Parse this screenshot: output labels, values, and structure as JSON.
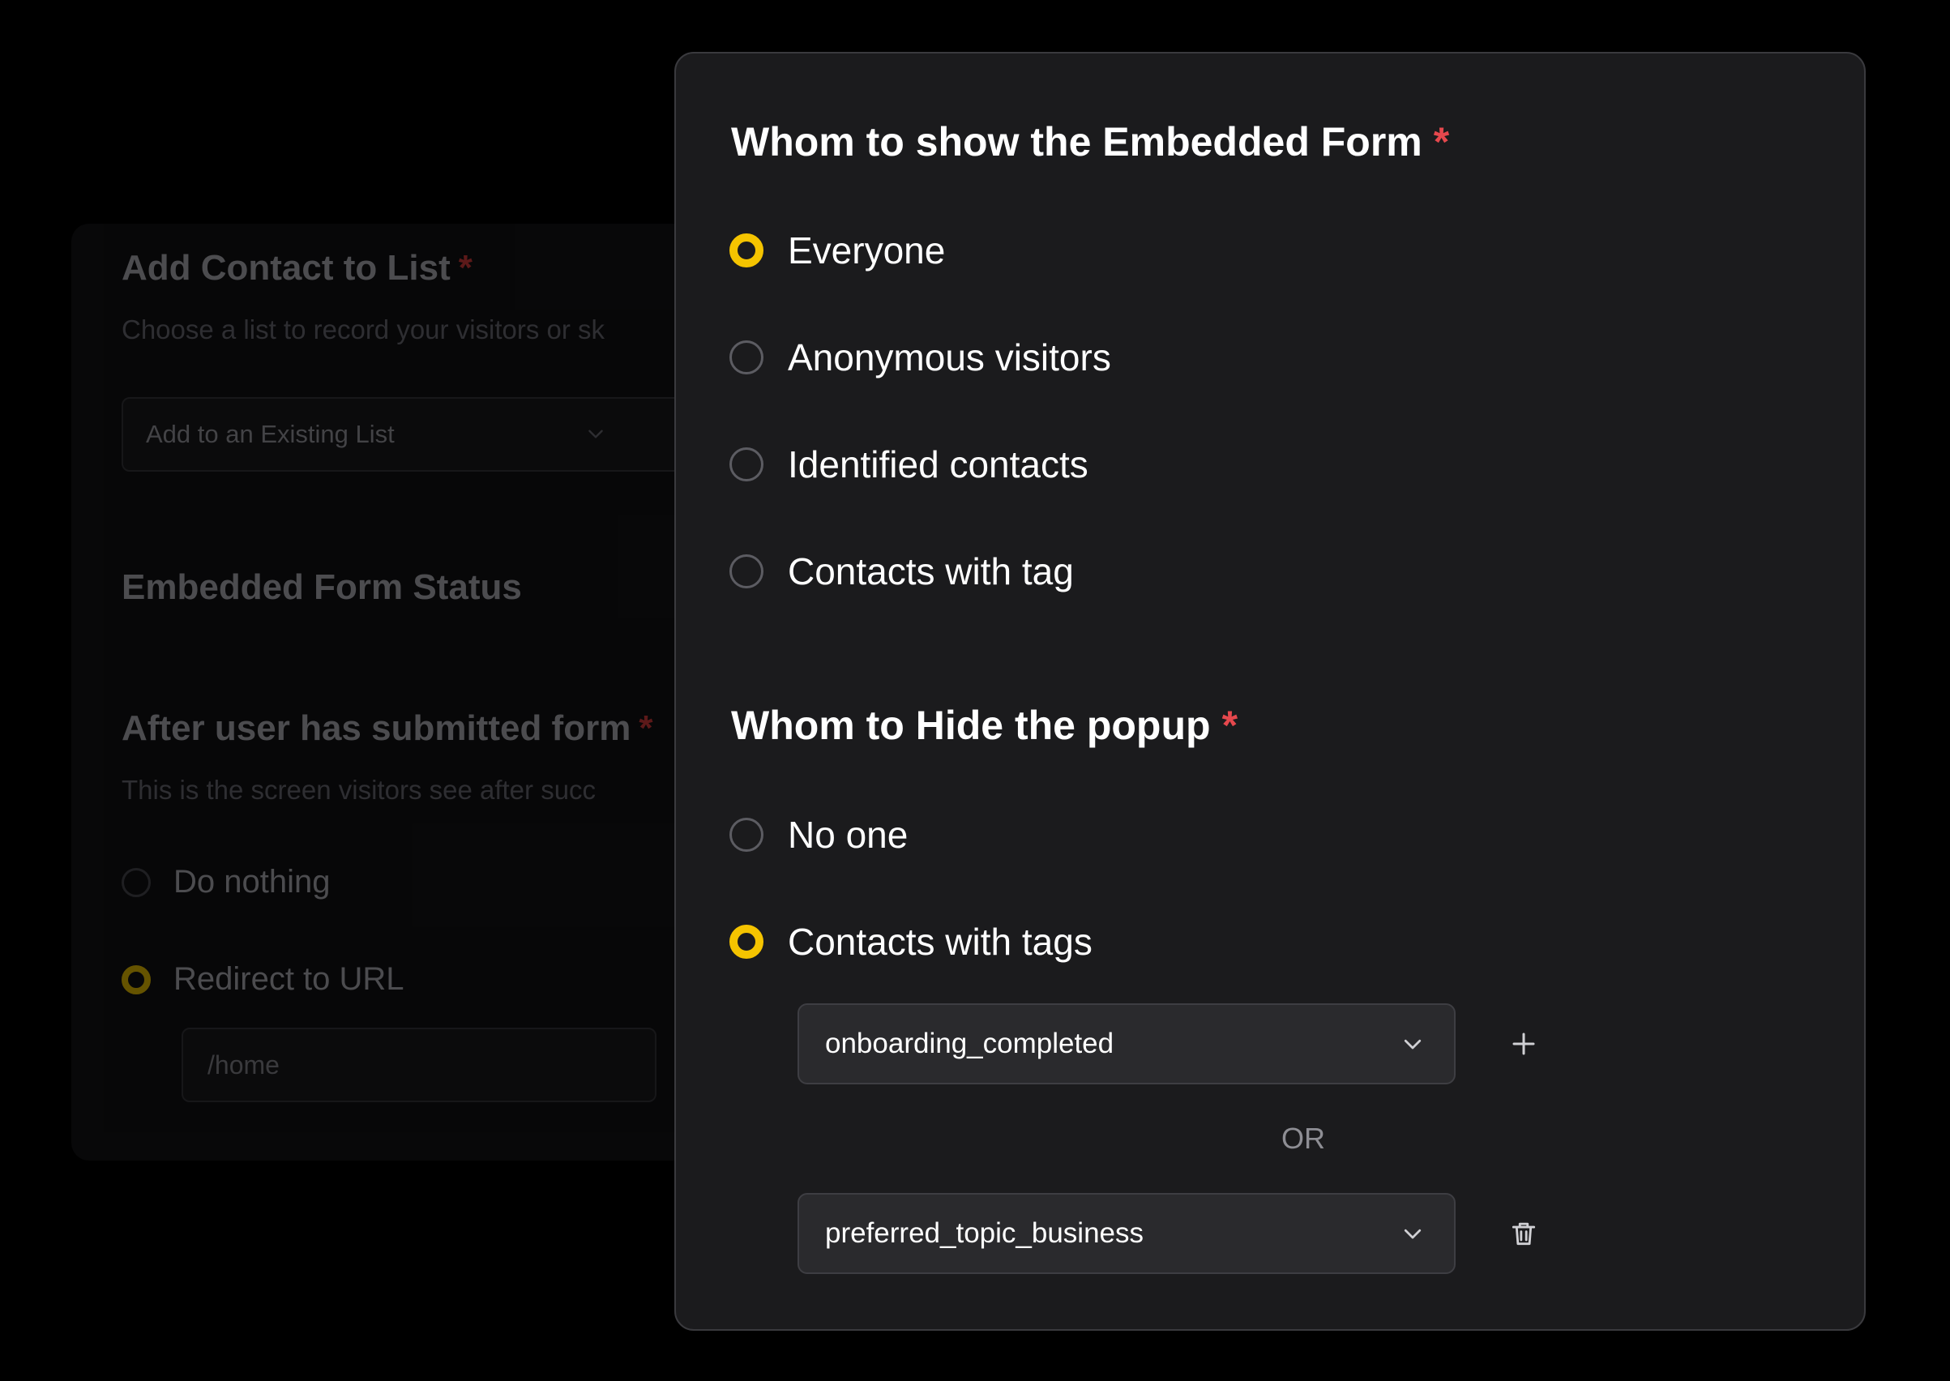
{
  "background_panel": {
    "list_title": "Add Contact to List",
    "list_required": "*",
    "list_subtitle": "Choose a list to record your visitors or sk",
    "list_select_value": "Add to an Existing List",
    "status_title": "Embedded Form Status",
    "after_title": "After user has submitted form",
    "after_required": "*",
    "after_subtitle": "This is the screen visitors see after succ",
    "options": [
      {
        "label": "Do nothing",
        "selected": false
      },
      {
        "label": "Redirect to URL",
        "selected": true
      }
    ],
    "url_value": "/home"
  },
  "modal": {
    "show_section": {
      "title": "Whom to show the Embedded Form",
      "required": "*",
      "options": [
        {
          "label": "Everyone",
          "selected": true
        },
        {
          "label": "Anonymous visitors",
          "selected": false
        },
        {
          "label": "Identified contacts",
          "selected": false
        },
        {
          "label": "Contacts with tag",
          "selected": false
        }
      ]
    },
    "hide_section": {
      "title": "Whom to Hide the popup",
      "required": "*",
      "options": [
        {
          "label": "No one",
          "selected": false
        },
        {
          "label": "Contacts with tags",
          "selected": true
        }
      ],
      "tags": [
        {
          "value": "onboarding_completed",
          "action_icon": "plus-icon"
        },
        {
          "value": "preferred_topic_business",
          "action_icon": "trash-icon"
        }
      ],
      "separator": "OR"
    }
  },
  "colors": {
    "accent": "#f5c400",
    "required": "#e5484d",
    "modal_bg": "#1b1b1d"
  }
}
